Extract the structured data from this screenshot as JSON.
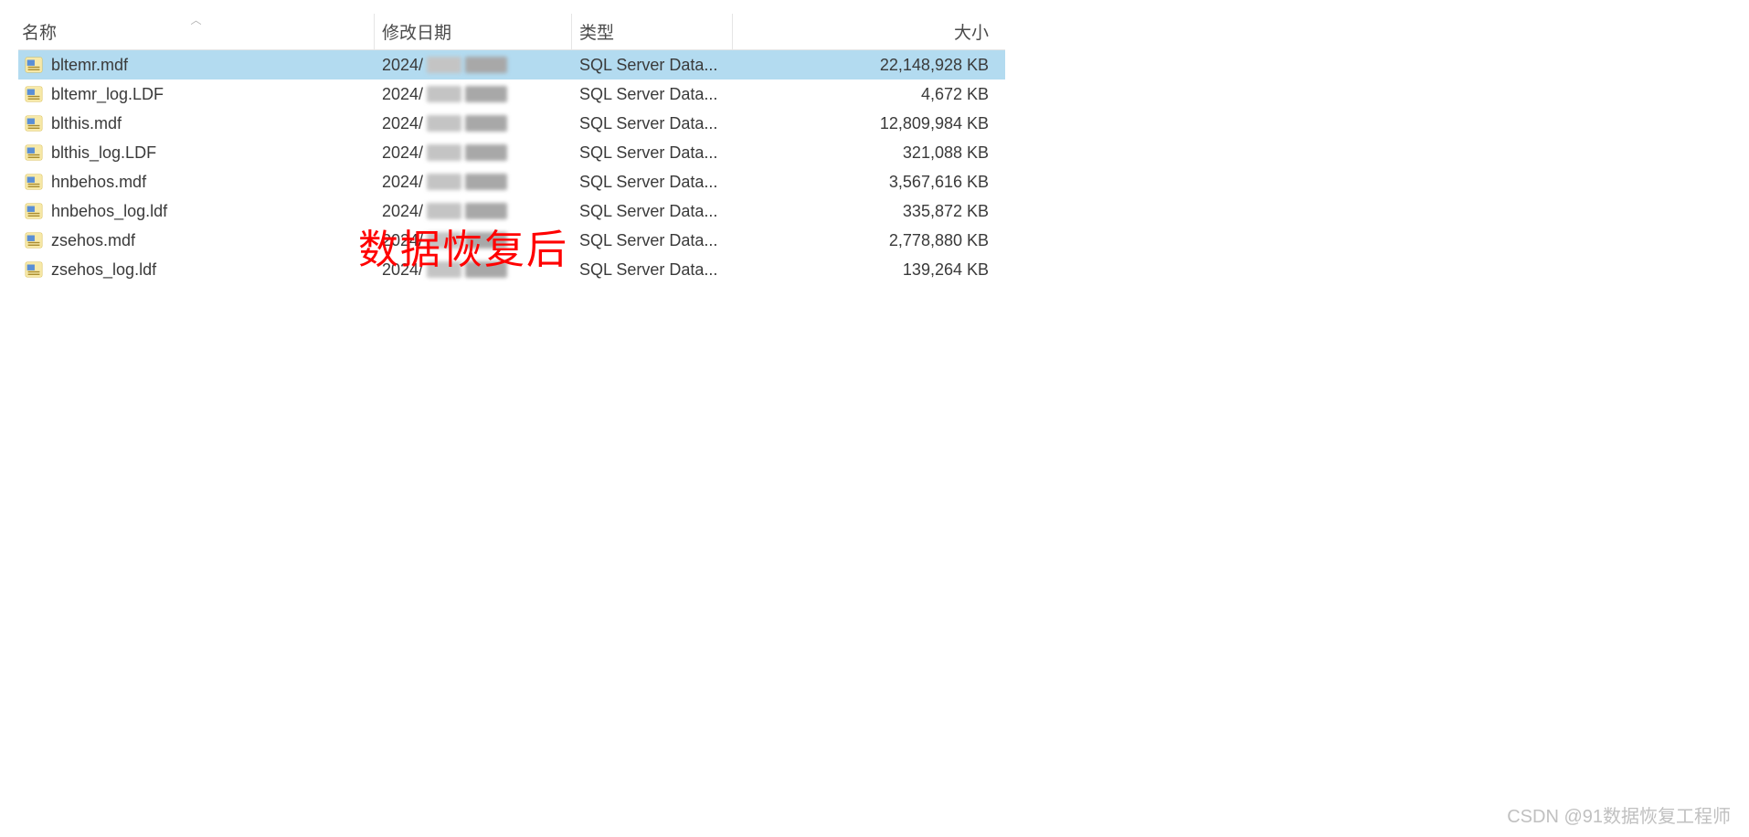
{
  "columns": {
    "name": "名称",
    "date": "修改日期",
    "type": "类型",
    "size": "大小"
  },
  "files": [
    {
      "name": "bltemr.mdf",
      "date_prefix": "2024/",
      "type": "SQL Server Data...",
      "size": "22,148,928 KB",
      "selected": true
    },
    {
      "name": "bltemr_log.LDF",
      "date_prefix": "2024/",
      "type": "SQL Server Data...",
      "size": "4,672 KB",
      "selected": false
    },
    {
      "name": "blthis.mdf",
      "date_prefix": "2024/",
      "type": "SQL Server Data...",
      "size": "12,809,984 KB",
      "selected": false
    },
    {
      "name": "blthis_log.LDF",
      "date_prefix": "2024/",
      "type": "SQL Server Data...",
      "size": "321,088 KB",
      "selected": false
    },
    {
      "name": "hnbehos.mdf",
      "date_prefix": "2024/",
      "type": "SQL Server Data...",
      "size": "3,567,616 KB",
      "selected": false
    },
    {
      "name": "hnbehos_log.ldf",
      "date_prefix": "2024/",
      "type": "SQL Server Data...",
      "size": "335,872 KB",
      "selected": false
    },
    {
      "name": "zsehos.mdf",
      "date_prefix": "2024/",
      "type": "SQL Server Data...",
      "size": "2,778,880 KB",
      "selected": false
    },
    {
      "name": "zsehos_log.ldf",
      "date_prefix": "2024/",
      "type": "SQL Server Data...",
      "size": "139,264 KB",
      "selected": false
    }
  ],
  "overlay": "数据恢复后",
  "watermark": "CSDN @91数据恢复工程师"
}
